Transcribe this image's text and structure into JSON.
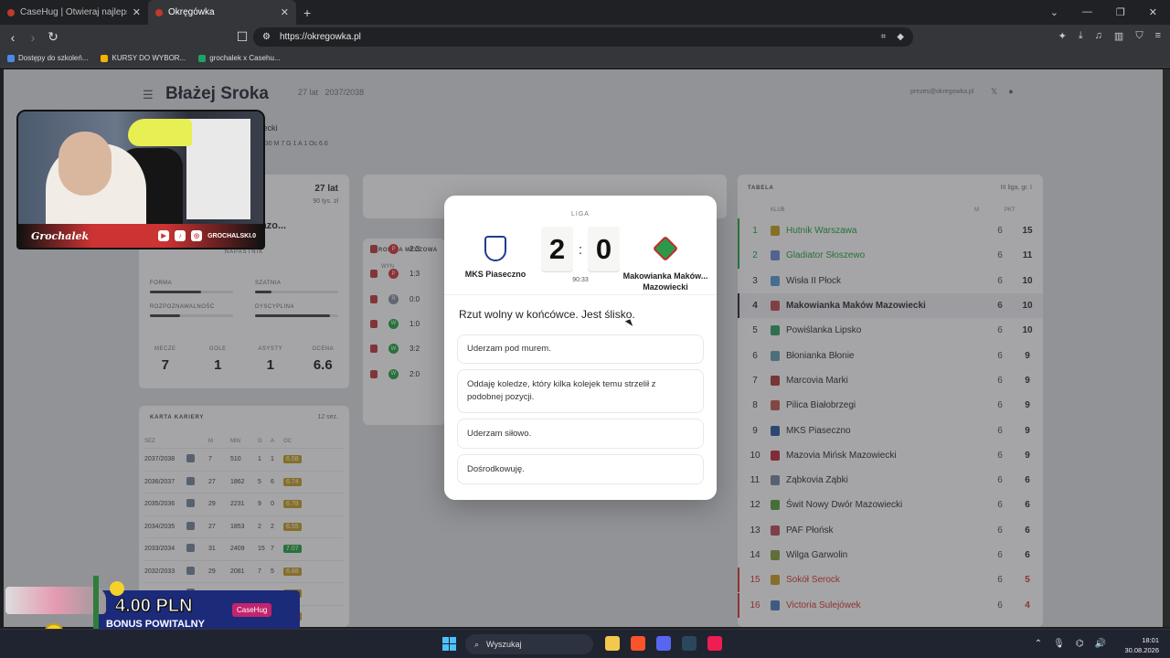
{
  "browser": {
    "tabs": [
      {
        "title": "CaseHug | Otwieraj najlepsze skrzynki",
        "active": false
      },
      {
        "title": "Okręgówka",
        "active": true
      }
    ],
    "url": "https://okregowka.pl",
    "bookmarks": [
      "Dostępy do szkoleń...",
      "KURSY DO WYBOR...",
      "grochalek x Casehu..."
    ]
  },
  "page": {
    "player_name": "Błażej Sroka",
    "age_short": "27 lat",
    "season": "2037/2038",
    "email": "prezes@okregowka.pl",
    "club_line": "owiecki",
    "stats_line": "6/30  M 7  G 1  A 1  Oc 6.6",
    "profile": {
      "age": "27 lat",
      "salary": "90 tys. zł",
      "club": "ków Mazo...",
      "position": "NAPASTNIK",
      "bars": [
        {
          "label": "FORMA",
          "value": 0.62
        },
        {
          "label": "SZATNIA",
          "value": 0.2
        },
        {
          "label": "ROZPOZNAWALNOŚĆ",
          "value": 0.36
        },
        {
          "label": "DYSCYPLINA",
          "value": 0.9
        }
      ],
      "numbers": [
        {
          "label": "MECZE",
          "value": "7"
        },
        {
          "label": "GOLE",
          "value": "1"
        },
        {
          "label": "ASYSTY",
          "value": "1"
        },
        {
          "label": "OCENA",
          "value": "6.6"
        }
      ]
    },
    "career": {
      "title": "KARTA KARIERY",
      "seasons_count": "12 sez.",
      "headers": [
        "SEZ",
        "",
        "M",
        "MIN",
        "G",
        "A",
        "OC"
      ],
      "rows": [
        [
          "2037/2038",
          "7",
          "510",
          "1",
          "1",
          "6.58"
        ],
        [
          "2036/2037",
          "27",
          "1862",
          "5",
          "6",
          "6.74"
        ],
        [
          "2035/2036",
          "29",
          "2231",
          "9",
          "0",
          "6.78"
        ],
        [
          "2034/2035",
          "27",
          "1853",
          "2",
          "2",
          "6.55"
        ],
        [
          "2033/2034",
          "31",
          "2409",
          "15",
          "7",
          "7.07"
        ],
        [
          "2032/2033",
          "29",
          "2081",
          "7",
          "5",
          "6.88"
        ],
        [
          "",
          "",
          "",
          "",
          "",
          "6.60"
        ],
        [
          "",
          "",
          "",
          "",
          "",
          "6.69"
        ]
      ]
    },
    "chronicle": {
      "title": "KRONIKA MECZOWA",
      "header": "WYN",
      "rows": [
        {
          "res": "P",
          "score": "2:3",
          "color": "#d63b3b"
        },
        {
          "res": "P",
          "score": "1:3",
          "color": "#d63b3b"
        },
        {
          "res": "R",
          "score": "0:0",
          "color": "#8a93a6"
        },
        {
          "res": "W",
          "score": "1:0",
          "color": "#27a745"
        },
        {
          "res": "W",
          "score": "3:2",
          "color": "#27a745"
        },
        {
          "res": "W",
          "score": "2:0",
          "color": "#27a745"
        }
      ]
    }
  },
  "table": {
    "title": "TABELA",
    "league": "III liga, gr. I",
    "headers": {
      "club": "KLUB",
      "m": "M",
      "pkt": "PKT"
    },
    "rows": [
      {
        "pos": "1",
        "club": "Hutnik Warszawa",
        "m": "6",
        "pkt": "15",
        "kind": "prom"
      },
      {
        "pos": "2",
        "club": "Gladiator Słoszewo",
        "m": "6",
        "pkt": "11",
        "kind": "prom"
      },
      {
        "pos": "3",
        "club": "Wisła II Płock",
        "m": "6",
        "pkt": "10",
        "kind": ""
      },
      {
        "pos": "4",
        "club": "Makowianka Maków Mazowiecki",
        "m": "6",
        "pkt": "10",
        "kind": "me"
      },
      {
        "pos": "5",
        "club": "Powiślanka Lipsko",
        "m": "6",
        "pkt": "10",
        "kind": ""
      },
      {
        "pos": "6",
        "club": "Błonianka Błonie",
        "m": "6",
        "pkt": "9",
        "kind": ""
      },
      {
        "pos": "7",
        "club": "Marcovia Marki",
        "m": "6",
        "pkt": "9",
        "kind": ""
      },
      {
        "pos": "8",
        "club": "Pilica Białobrzegi",
        "m": "6",
        "pkt": "9",
        "kind": ""
      },
      {
        "pos": "9",
        "club": "MKS Piaseczno",
        "m": "6",
        "pkt": "9",
        "kind": ""
      },
      {
        "pos": "10",
        "club": "Mazovia Mińsk Mazowiecki",
        "m": "6",
        "pkt": "9",
        "kind": ""
      },
      {
        "pos": "11",
        "club": "Ząbkovia Ząbki",
        "m": "6",
        "pkt": "6",
        "kind": ""
      },
      {
        "pos": "12",
        "club": "Świt Nowy Dwór Mazowiecki",
        "m": "6",
        "pkt": "6",
        "kind": ""
      },
      {
        "pos": "13",
        "club": "PAF Płońsk",
        "m": "6",
        "pkt": "6",
        "kind": ""
      },
      {
        "pos": "14",
        "club": "Wilga Garwolin",
        "m": "6",
        "pkt": "6",
        "kind": ""
      },
      {
        "pos": "15",
        "club": "Sokół Serock",
        "m": "6",
        "pkt": "5",
        "kind": "rel"
      },
      {
        "pos": "16",
        "club": "Victoria Sulejówek",
        "m": "6",
        "pkt": "4",
        "kind": "rel"
      }
    ]
  },
  "modal": {
    "league": "LIGA",
    "home": "MKS Piaseczno",
    "away": "Makowianka Maków Mazowiecki",
    "away_display": "Makowianka Maków... Mazowiecki",
    "home_score": "2",
    "away_score": "0",
    "time": "90:33",
    "question": "Rzut wolny w końcówce. Jest ślisko.",
    "options": [
      "Uderzam pod murem.",
      "Oddaję koledze, który kilka kolejek temu strzelił z podobnej pozycji.",
      "Uderzam siłowo.",
      "Dośrodkowuję."
    ]
  },
  "stream": {
    "cam_tag": "Grochalek",
    "handle": "GROCHALSKI.0",
    "promo_amount": "4.00 PLN",
    "promo_text": "BONUS POWITALNY",
    "promo_logo": "CaseHug"
  },
  "taskbar": {
    "search": "Wyszukaj",
    "time": "18:01",
    "date": "30.08.2026"
  }
}
